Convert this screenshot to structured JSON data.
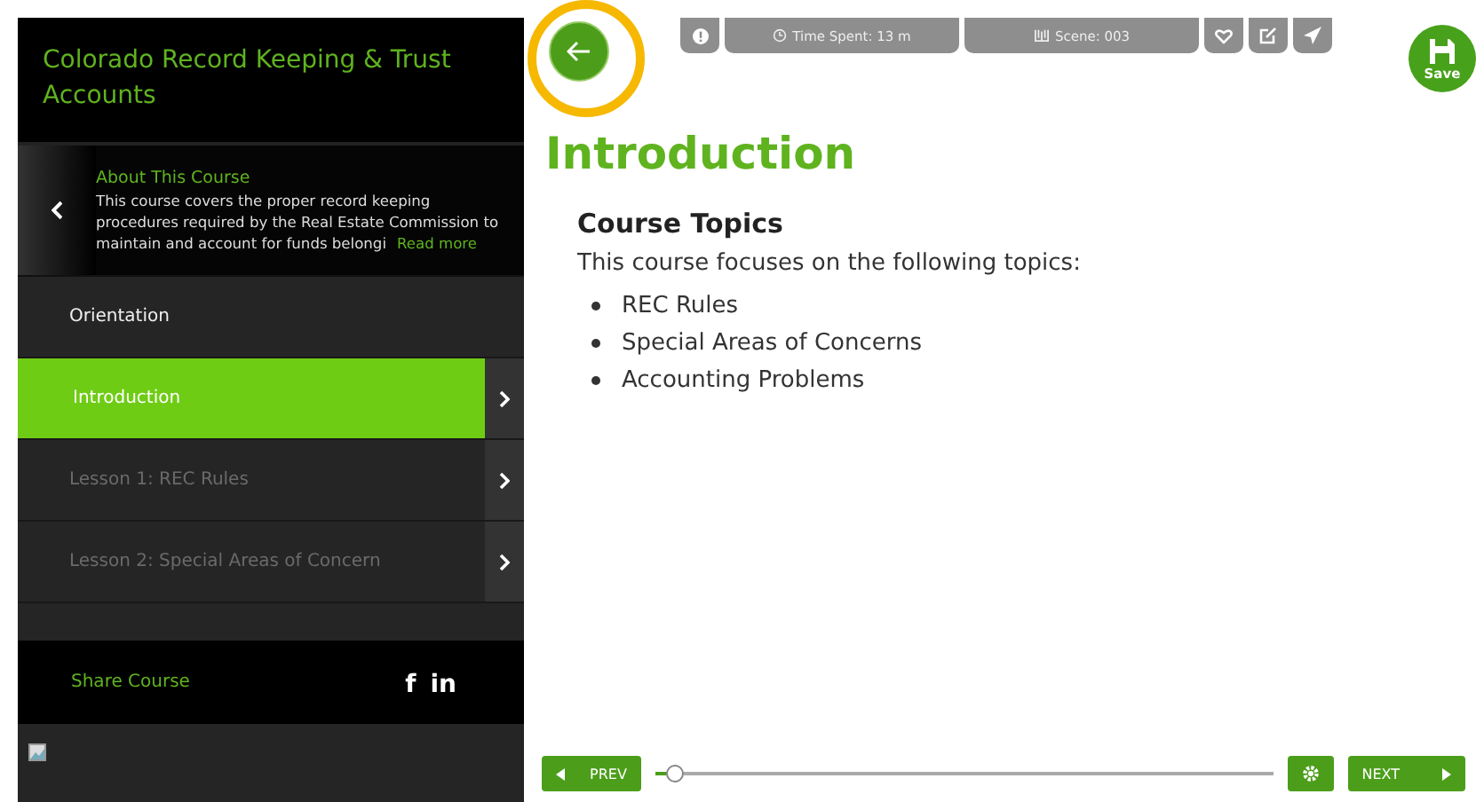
{
  "sidebar": {
    "course_title": "Colorado Record Keeping & Trust Accounts",
    "about": {
      "heading": "About This Course",
      "text": "This course covers the proper record keeping procedures required by the Real Estate Commission to maintain and account for funds belongi",
      "read_more": "Read more"
    },
    "items": [
      {
        "label": "Orientation",
        "selected": false,
        "disabled": false,
        "has_arrow": false
      },
      {
        "label": "Introduction",
        "selected": true,
        "disabled": false,
        "has_arrow": true
      },
      {
        "label": "Lesson 1: REC Rules",
        "selected": false,
        "disabled": true,
        "has_arrow": true
      },
      {
        "label": "Lesson 2: Special Areas of Concern",
        "selected": false,
        "disabled": true,
        "has_arrow": true
      }
    ],
    "share": {
      "label": "Share Course",
      "facebook": "f",
      "linkedin": "in"
    }
  },
  "toolbar": {
    "time_spent": "Time Spent: 13 m",
    "scene": "Scene: 003",
    "save": "Save"
  },
  "content": {
    "title": "Introduction",
    "heading": "Course Topics",
    "intro": "This course focuses on the following topics:",
    "topics": [
      "REC Rules",
      "Special Areas of Concerns",
      "Accounting Problems"
    ]
  },
  "footer": {
    "prev": "PREV",
    "next": "NEXT",
    "progress": {
      "level": 0.03
    }
  }
}
